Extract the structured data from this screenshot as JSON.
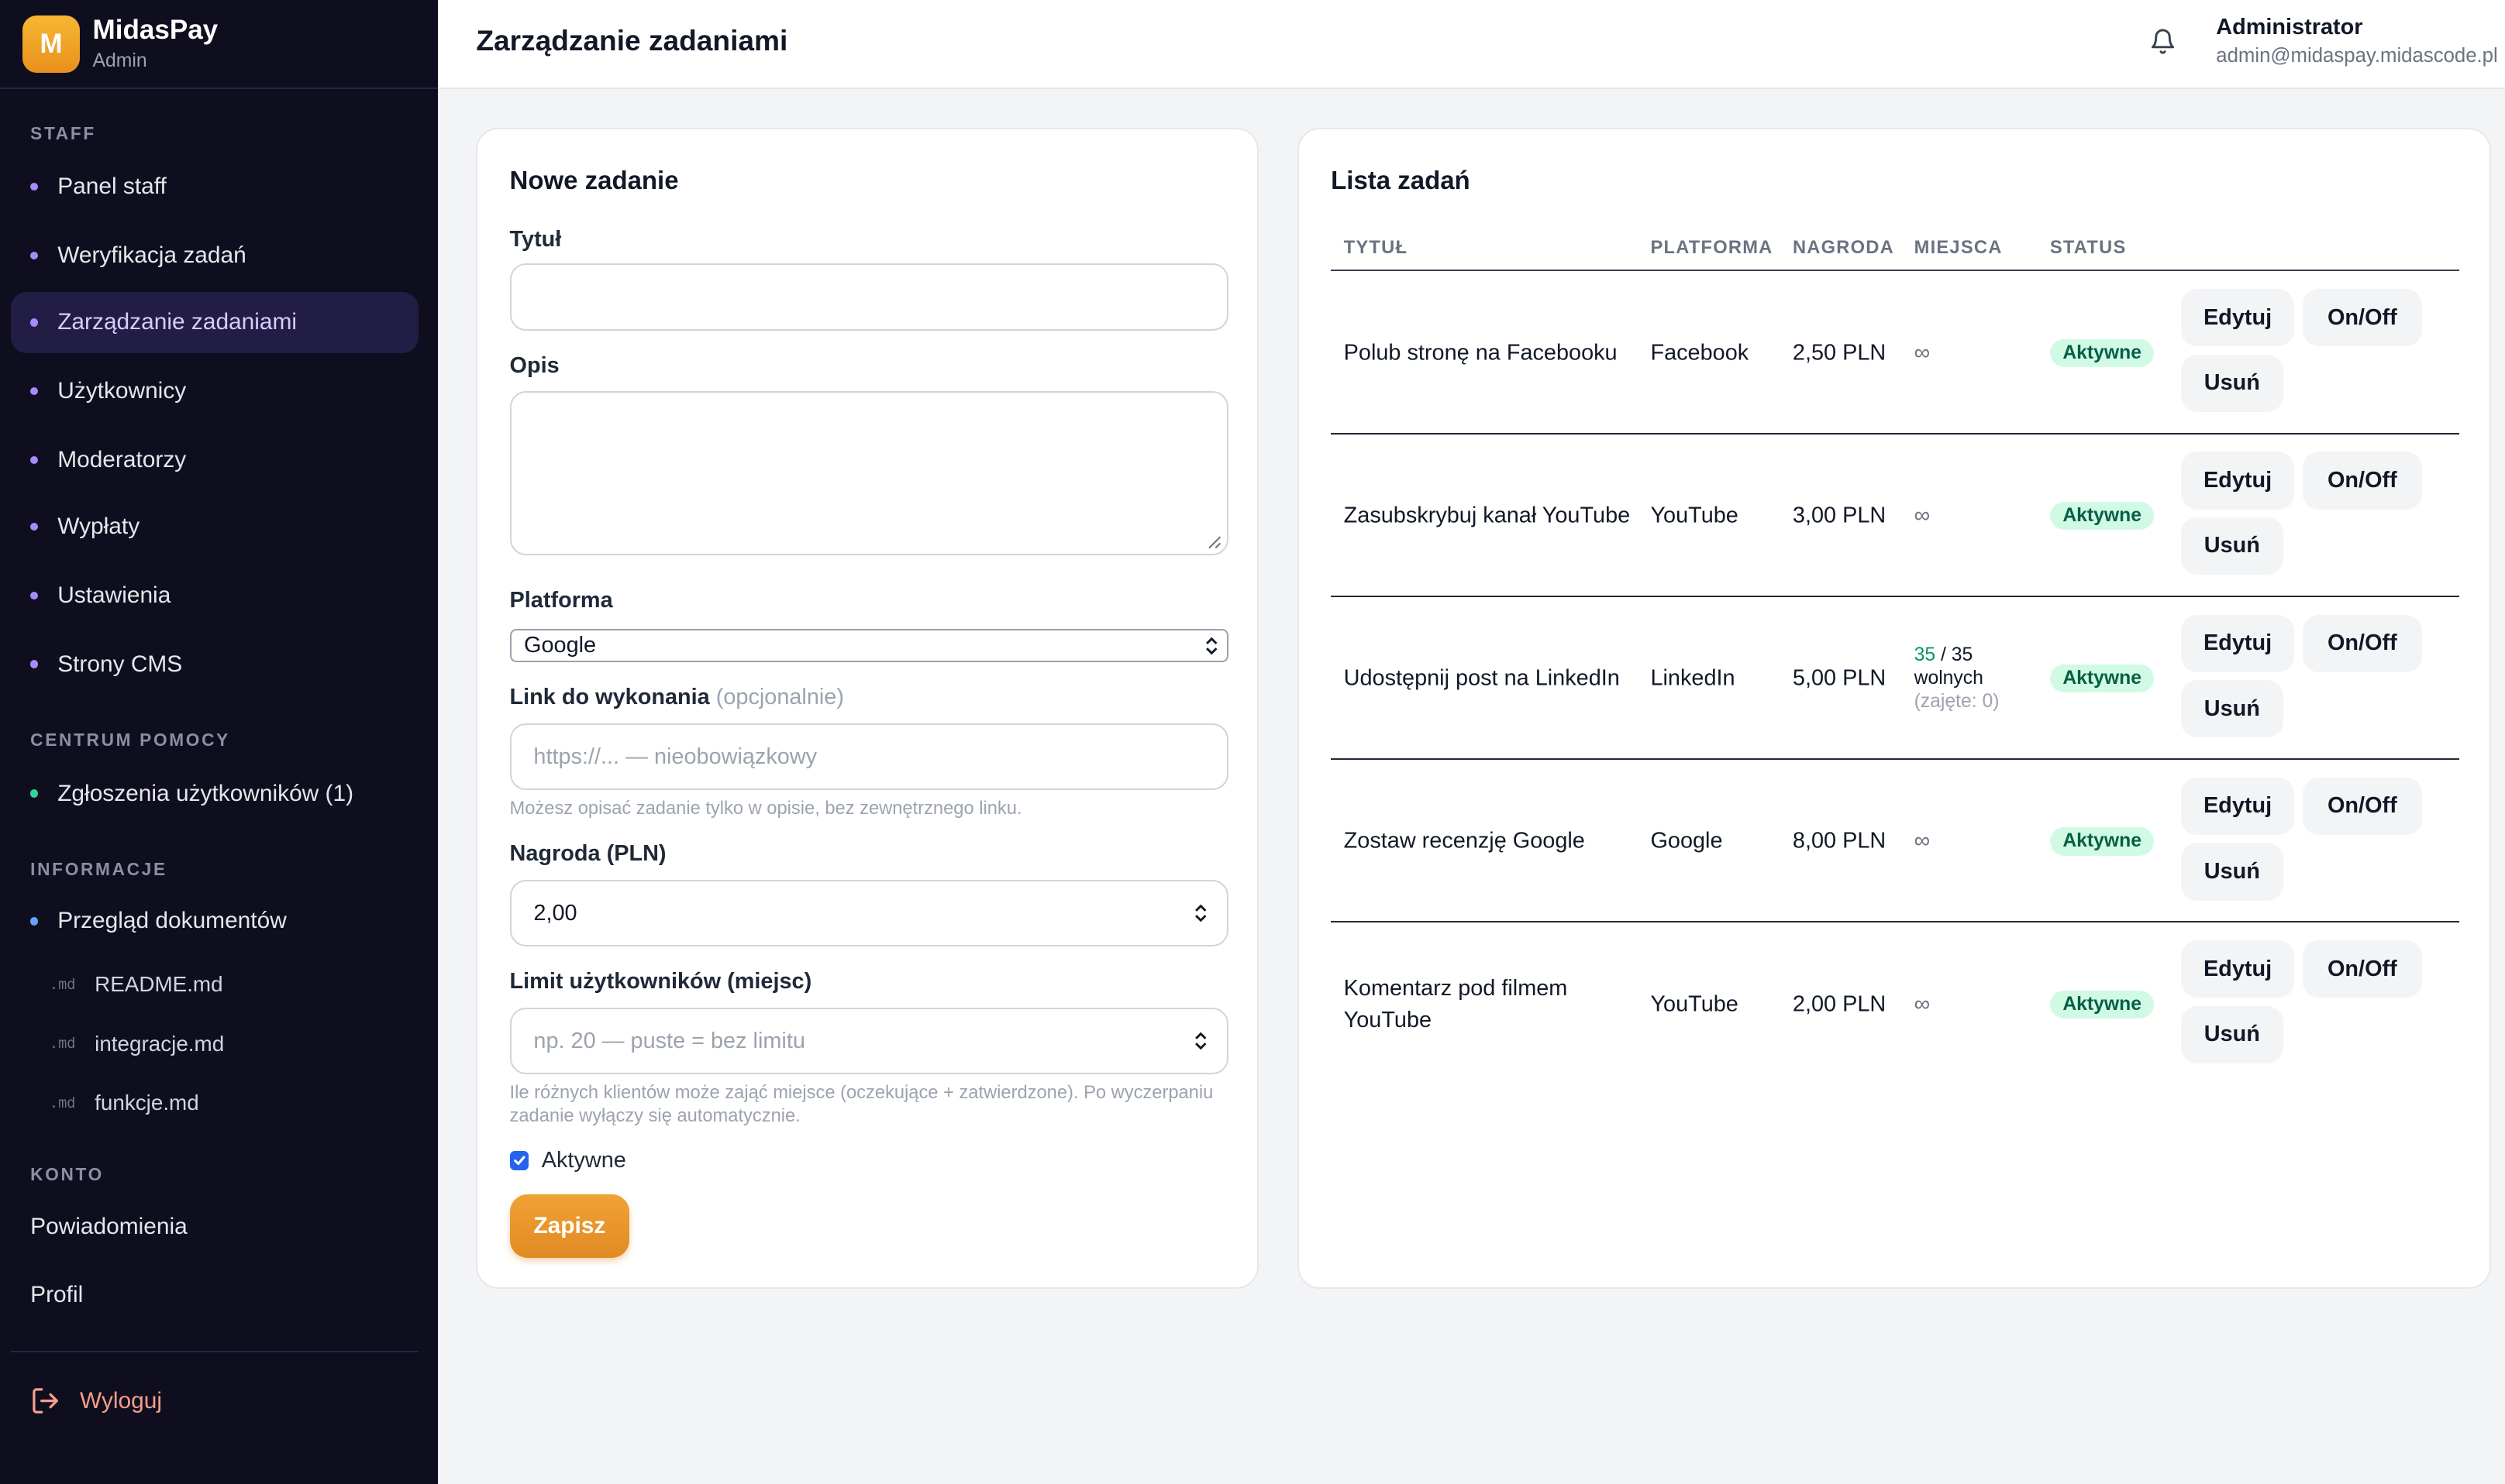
{
  "brand": {
    "logo_letter": "M",
    "name": "MidasPay",
    "role": "Admin"
  },
  "sidebar": {
    "staff_title": "STAFF",
    "staff_items": [
      "Panel staff",
      "Weryfikacja zadań",
      "Zarządzanie zadaniami",
      "Użytkownicy",
      "Moderatorzy",
      "Wypłaty",
      "Ustawienia",
      "Strony CMS"
    ],
    "help_title": "CENTRUM POMOCY",
    "help_items": [
      "Zgłoszenia użytkowników (1)"
    ],
    "info_title": "INFORMACJE",
    "info_item": "Przegląd dokumentów",
    "doc_tag": ".md",
    "docs": [
      "README.md",
      "integracje.md",
      "funkcje.md"
    ],
    "account_title": "KONTO",
    "account_items": [
      "Powiadomienia",
      "Profil"
    ],
    "logout": "Wyloguj"
  },
  "header": {
    "title": "Zarządzanie zadaniami",
    "user_name": "Administrator",
    "user_email": "admin@midaspay.midascode.pl"
  },
  "form": {
    "title": "Nowe zadanie",
    "title_label": "Tytuł",
    "title_value": "",
    "desc_label": "Opis",
    "desc_value": "",
    "platform_label": "Platforma",
    "platform_value": "Google",
    "link_label": "Link do wykonania",
    "link_optional": "(opcjonalnie)",
    "link_placeholder": "https://... — nieobowiązkowy",
    "link_hint": "Możesz opisać zadanie tylko w opisie, bez zewnętrznego linku.",
    "reward_label": "Nagroda (PLN)",
    "reward_value": "2,00",
    "limit_label": "Limit użytkowników (miejsc)",
    "limit_placeholder": "np. 20 — puste = bez limitu",
    "limit_hint": "Ile różnych klientów może zająć miejsce (oczekujące + zatwierdzone). Po wyczerpaniu zadanie wyłączy się automatycznie.",
    "active_label": "Aktywne",
    "active_checked": true,
    "save_label": "Zapisz"
  },
  "tasks": {
    "title": "Lista zadań",
    "columns": [
      "TYTUŁ",
      "PLATFORMA",
      "NAGRODA",
      "MIEJSCA",
      "STATUS"
    ],
    "edit_label": "Edytuj",
    "toggle_label": "On/Off",
    "delete_label": "Usuń",
    "rows": [
      {
        "title": "Polub stronę na Facebooku",
        "platform": "Facebook",
        "reward": "2,50 PLN",
        "seats": "∞",
        "status": "Aktywne"
      },
      {
        "title": "Zasubskrybuj kanał YouTube",
        "platform": "YouTube",
        "reward": "3,00 PLN",
        "seats": "∞",
        "status": "Aktywne"
      },
      {
        "title": "Udostępnij post na LinkedIn",
        "platform": "LinkedIn",
        "reward": "5,00 PLN",
        "seats_free": "35",
        "seats_total": "/ 35",
        "seats_free_label": "wolnych",
        "seats_taken": "(zajęte: 0)",
        "status": "Aktywne"
      },
      {
        "title": "Zostaw recenzję Google",
        "platform": "Google",
        "reward": "8,00 PLN",
        "seats": "∞",
        "status": "Aktywne"
      },
      {
        "title": "Komentarz pod filmem YouTube",
        "platform": "YouTube",
        "reward": "2,00 PLN",
        "seats": "∞",
        "status": "Aktywne"
      }
    ]
  }
}
